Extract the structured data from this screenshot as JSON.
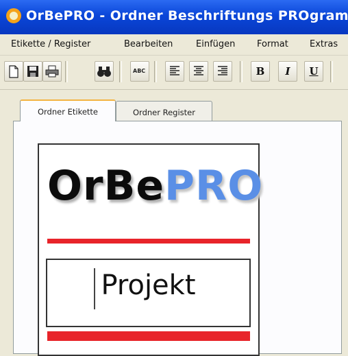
{
  "window": {
    "title": "OrBePRO - Ordner Beschriftungs PROgramm"
  },
  "menu": {
    "items": [
      {
        "label": "Etikette / Register"
      },
      {
        "label": "Bearbeiten"
      },
      {
        "label": "Einfügen"
      },
      {
        "label": "Format"
      },
      {
        "label": "Extras"
      }
    ]
  },
  "toolbar": {
    "buttons": [
      {
        "icon": "new-document-icon"
      },
      {
        "icon": "save-icon"
      },
      {
        "icon": "print-icon"
      },
      {
        "icon": "binoculars-icon"
      },
      {
        "icon": "spellcheck-icon",
        "label": "ABC"
      },
      {
        "icon": "align-left-icon"
      },
      {
        "icon": "align-center-icon"
      },
      {
        "icon": "align-right-icon"
      },
      {
        "icon": "bold-icon",
        "label": "B"
      },
      {
        "icon": "italic-icon",
        "label": "I"
      },
      {
        "icon": "underline-icon",
        "label": "U"
      }
    ]
  },
  "tabs": [
    {
      "label": "Ordner Etikette",
      "active": true
    },
    {
      "label": "Ordner Register",
      "active": false
    }
  ],
  "label_preview": {
    "logo_part_a": "OrBe",
    "logo_part_b": "PRO",
    "project_text": "Projekt"
  },
  "colors": {
    "titlebar": "#0a46d8",
    "accent_red": "#e8242a",
    "logo_blue": "#5a8fe6",
    "window_bg": "#ece9d8"
  }
}
